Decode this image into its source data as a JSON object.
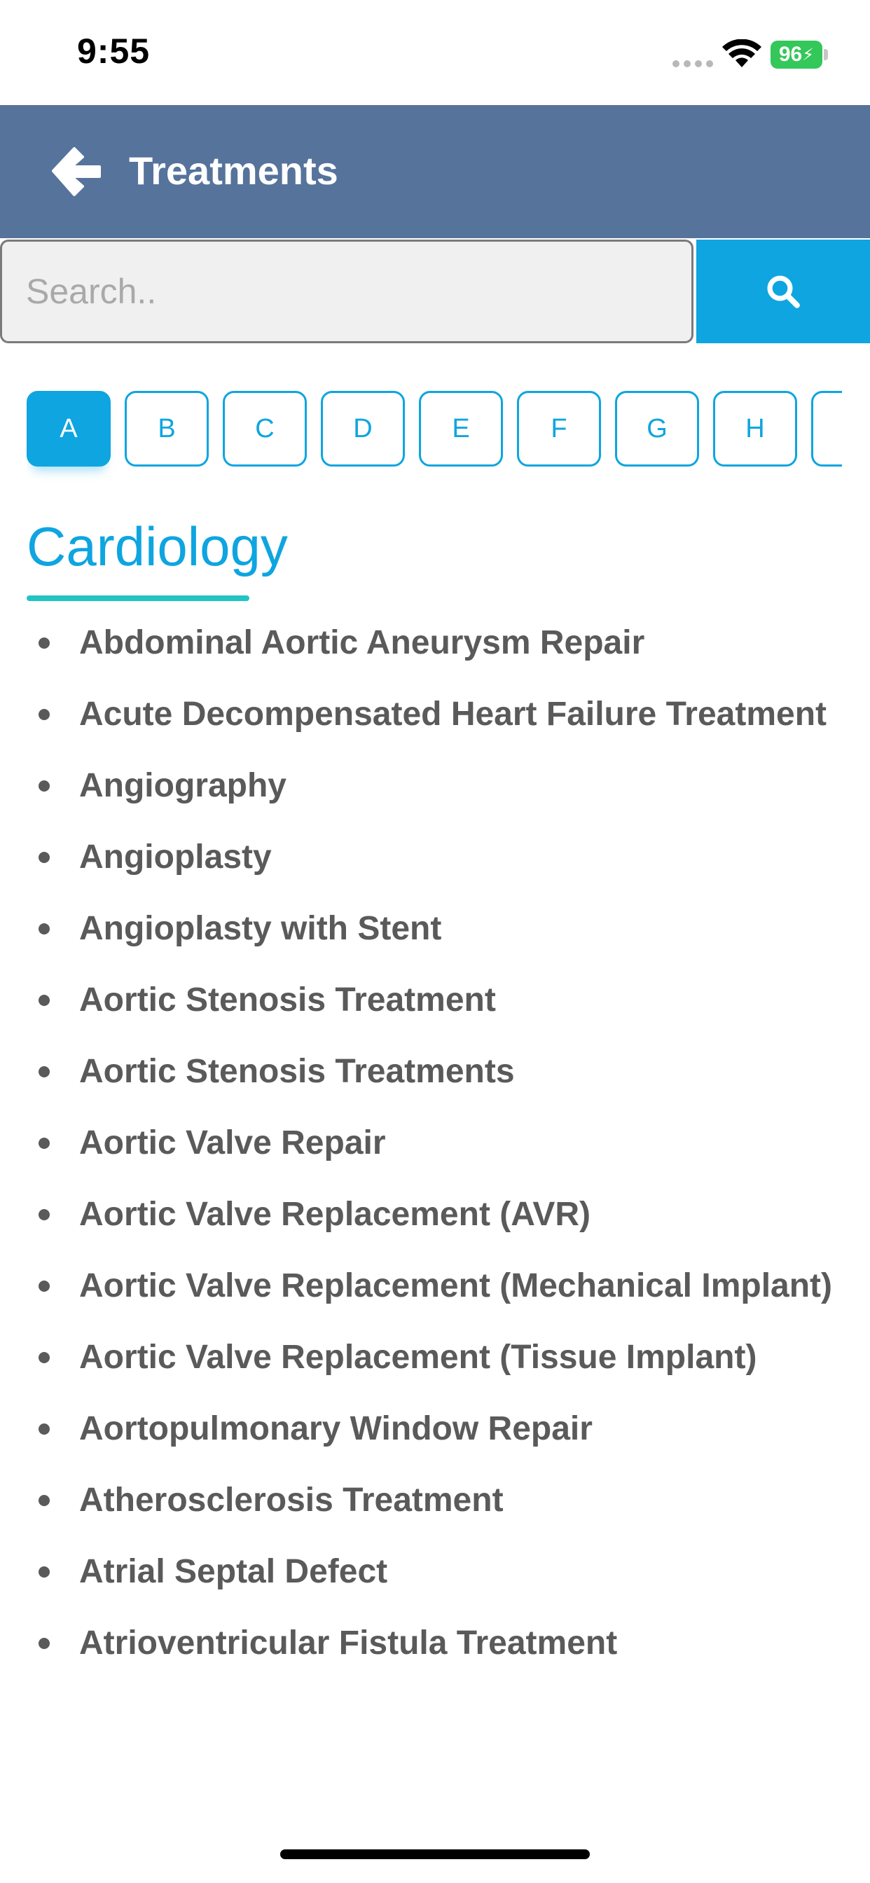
{
  "status_bar": {
    "time": "9:55",
    "battery": "96",
    "icons": [
      "signal-dots-icon",
      "wifi-icon",
      "battery-charging-icon"
    ]
  },
  "header": {
    "title": "Treatments",
    "back_icon": "arrow-left-icon",
    "background_color": "#56739b"
  },
  "search": {
    "placeholder": "Search..",
    "value": "",
    "button_icon": "search-icon",
    "button_color": "#0ea5e0"
  },
  "letters": {
    "items": [
      "A",
      "B",
      "C",
      "D",
      "E",
      "F",
      "G",
      "H"
    ],
    "active": "A",
    "accent_color": "#0ea5e0"
  },
  "section": {
    "title": "Cardiology",
    "title_color": "#0ea5e0",
    "underline_color": "#22c3c3"
  },
  "treatments": [
    "Abdominal Aortic Aneurysm Repair",
    "Acute Decompensated Heart Failure Treatment",
    "Angiography",
    "Angioplasty",
    "Angioplasty with Stent",
    "Aortic Stenosis Treatment",
    "Aortic Stenosis Treatments",
    "Aortic Valve Repair",
    "Aortic Valve Replacement (AVR)",
    "Aortic Valve Replacement (Mechanical Implant)",
    "Aortic Valve Replacement (Tissue Implant)",
    "Aortopulmonary Window Repair",
    "Atherosclerosis Treatment",
    "Atrial Septal Defect",
    "Atrioventricular Fistula Treatment"
  ]
}
